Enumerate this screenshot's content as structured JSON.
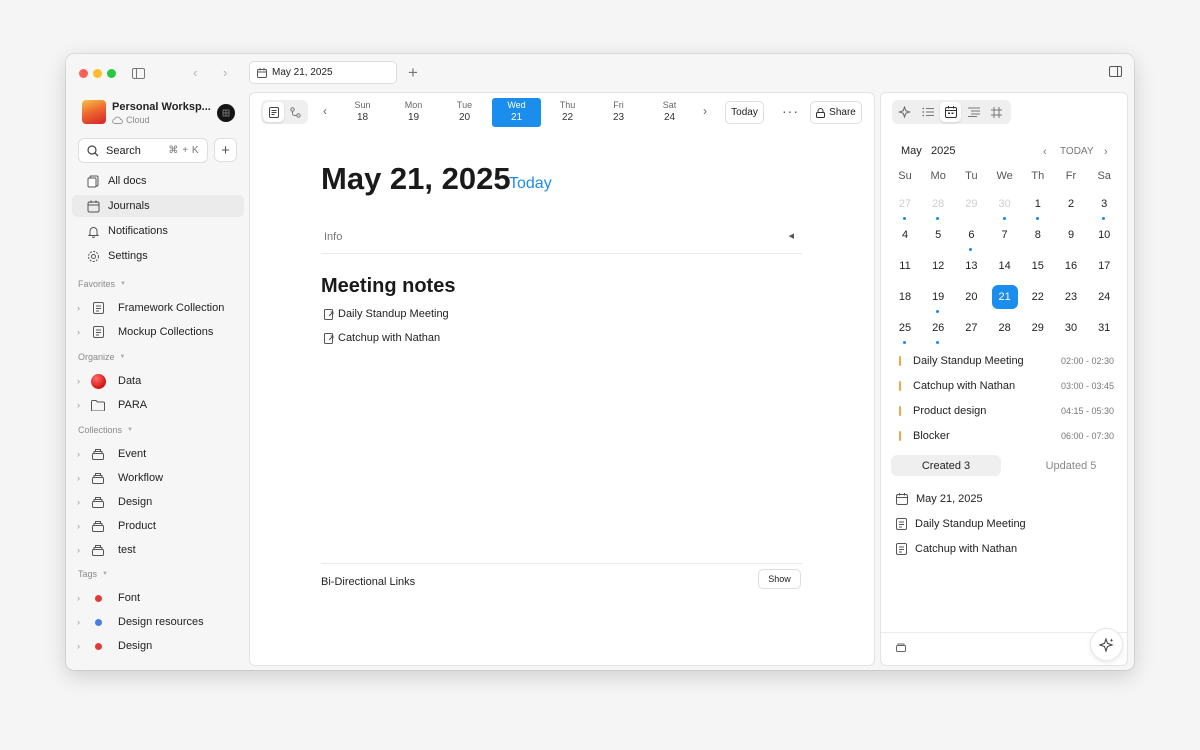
{
  "window": {
    "traffic_colors": [
      "#ff5f57",
      "#febc2e",
      "#28c840"
    ]
  },
  "tab": {
    "label": "May 21, 2025"
  },
  "workspace": {
    "name": "Personal Worksp...",
    "status": "Cloud"
  },
  "search": {
    "label": "Search",
    "shortcut": "⌘ + K"
  },
  "nav": {
    "all_docs": "All docs",
    "journals": "Journals",
    "notifications": "Notifications",
    "settings": "Settings"
  },
  "sections": {
    "favorites": "Favorites",
    "organize": "Organize",
    "collections": "Collections",
    "tags": "Tags"
  },
  "favorites": [
    {
      "label": "Framework Collection"
    },
    {
      "label": "Mockup Collections"
    }
  ],
  "organize": [
    {
      "label": "Data",
      "icon": "red-circle-icon"
    },
    {
      "label": "PARA",
      "icon": "folder-icon"
    }
  ],
  "collections": [
    {
      "label": "Event"
    },
    {
      "label": "Workflow"
    },
    {
      "label": "Design"
    },
    {
      "label": "Product"
    },
    {
      "label": "test"
    }
  ],
  "tags": [
    {
      "label": "Font",
      "color": "#e03a3a"
    },
    {
      "label": "Design resources",
      "color": "#4a7fe0"
    },
    {
      "label": "Design",
      "color": "#e03a3a"
    }
  ],
  "week": {
    "days": [
      {
        "name": "Sun",
        "date": "18"
      },
      {
        "name": "Mon",
        "date": "19"
      },
      {
        "name": "Tue",
        "date": "20"
      },
      {
        "name": "Wed",
        "date": "21"
      },
      {
        "name": "Thu",
        "date": "22"
      },
      {
        "name": "Fri",
        "date": "23"
      },
      {
        "name": "Sat",
        "date": "24"
      }
    ],
    "selected_index": 3
  },
  "toolbar": {
    "today": "Today",
    "share": "Share"
  },
  "doc": {
    "title": "May 21, 2025",
    "title_badge": "Today",
    "info_label": "Info",
    "section_heading": "Meeting notes",
    "links": [
      "Daily Standup Meeting",
      "Catchup with Nathan"
    ],
    "bidirectional_label": "Bi-Directional Links",
    "show_label": "Show"
  },
  "calendar": {
    "month": "May",
    "year": "2025",
    "today_label": "TODAY",
    "weekdays": [
      "Su",
      "Mo",
      "Tu",
      "We",
      "Th",
      "Fr",
      "Sa"
    ],
    "cells": [
      {
        "d": "27",
        "dim": true,
        "ev": true
      },
      {
        "d": "28",
        "dim": true,
        "ev": true
      },
      {
        "d": "29",
        "dim": true
      },
      {
        "d": "30",
        "dim": true,
        "ev": true
      },
      {
        "d": "1",
        "ev": true
      },
      {
        "d": "2"
      },
      {
        "d": "3",
        "ev": true
      },
      {
        "d": "4"
      },
      {
        "d": "5"
      },
      {
        "d": "6",
        "ev": true
      },
      {
        "d": "7"
      },
      {
        "d": "8"
      },
      {
        "d": "9"
      },
      {
        "d": "10"
      },
      {
        "d": "11"
      },
      {
        "d": "12"
      },
      {
        "d": "13"
      },
      {
        "d": "14"
      },
      {
        "d": "15"
      },
      {
        "d": "16"
      },
      {
        "d": "17"
      },
      {
        "d": "18"
      },
      {
        "d": "19",
        "ev": true
      },
      {
        "d": "20"
      },
      {
        "d": "21",
        "sel": true
      },
      {
        "d": "22"
      },
      {
        "d": "23"
      },
      {
        "d": "24"
      },
      {
        "d": "25",
        "ev": true
      },
      {
        "d": "26",
        "ev": true
      },
      {
        "d": "27"
      },
      {
        "d": "28"
      },
      {
        "d": "29"
      },
      {
        "d": "30"
      },
      {
        "d": "31"
      }
    ],
    "accent": "#1b8ded"
  },
  "events": [
    {
      "name": "Daily Standup Meeting",
      "time": "02:00 - 02:30"
    },
    {
      "name": "Catchup with Nathan",
      "time": "03:00 - 03:45"
    },
    {
      "name": "Product design",
      "time": "04:15 - 05:30"
    },
    {
      "name": "Blocker",
      "time": "06:00 - 07:30"
    }
  ],
  "event_bar_color": "#f5a54a",
  "activity": {
    "created_label": "Created 3",
    "updated_label": "Updated 5",
    "docs": [
      {
        "label": "May 21, 2025",
        "icon": "calendar-icon"
      },
      {
        "label": "Daily Standup Meeting",
        "icon": "page-icon"
      },
      {
        "label": "Catchup with Nathan",
        "icon": "page-icon"
      }
    ]
  }
}
